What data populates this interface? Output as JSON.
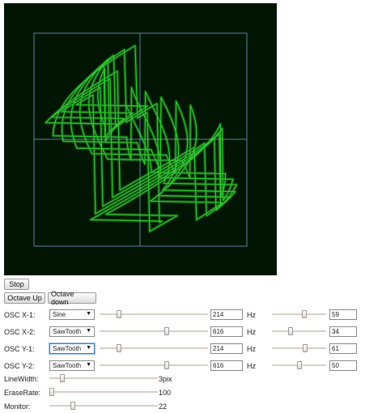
{
  "buttons": {
    "stop": "Stop",
    "octave_up": "Octave Up",
    "octave_down": "Octave down"
  },
  "oscillators": [
    {
      "label": "OSC X-1:",
      "wave": "Sine",
      "freq_slider": 0.18,
      "freq": "214",
      "unit": "Hz",
      "phase_slider": 0.59,
      "phase": "59"
    },
    {
      "label": "OSC X-2:",
      "wave": "SawTooth",
      "freq_slider": 0.62,
      "freq": "616",
      "unit": "Hz",
      "phase_slider": 0.34,
      "phase": "34"
    },
    {
      "label": "OSC Y-1:",
      "wave": "SawTooth",
      "freq_slider": 0.18,
      "freq": "214",
      "unit": "Hz",
      "phase_slider": 0.61,
      "phase": "61"
    },
    {
      "label": "OSC Y-2:",
      "wave": "SawTooth",
      "freq_slider": 0.62,
      "freq": "616",
      "unit": "Hz",
      "phase_slider": 0.5,
      "phase": "50"
    }
  ],
  "settings": {
    "line_width": {
      "label": "LineWidth:",
      "value": "3pix",
      "slider": 0.12
    },
    "erase_rate": {
      "label": "EraseRate:",
      "value": "100",
      "slider": 0.02
    },
    "monitor": {
      "label": "Monitor:",
      "value": "22",
      "slider": 0.22
    }
  },
  "colors": {
    "scope_bg": "#021502",
    "trace": "#39e83a",
    "grid": "#5d7fa3"
  }
}
